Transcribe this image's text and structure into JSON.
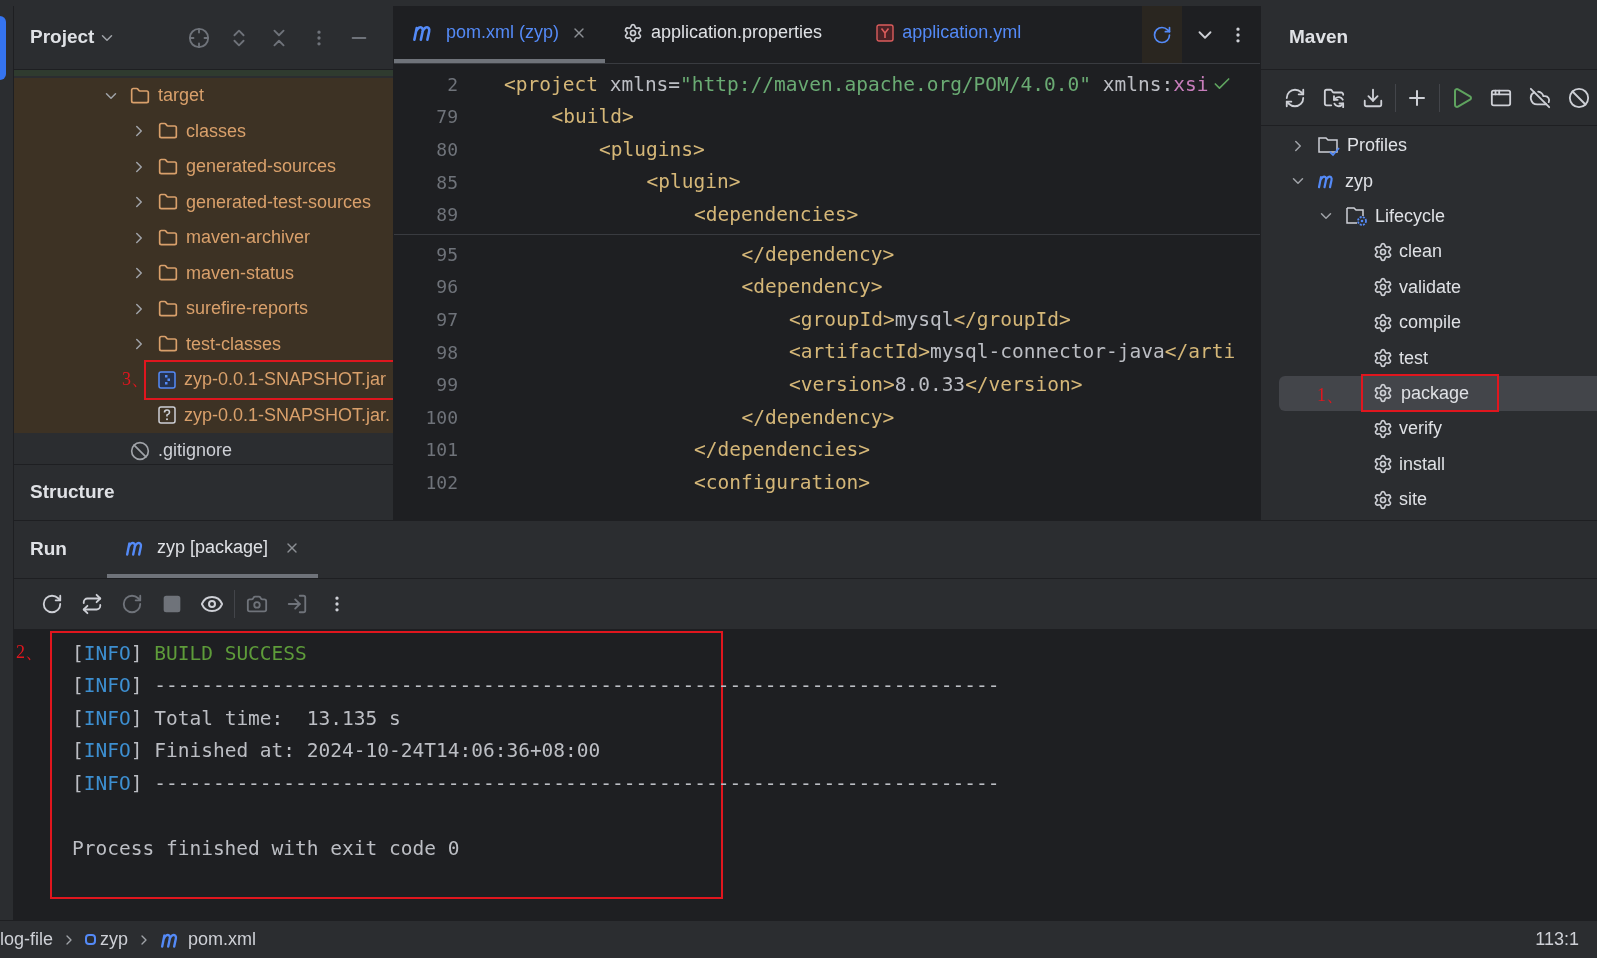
{
  "project_panel": {
    "title": "Project",
    "tree": [
      {
        "label": "target",
        "kind": "folder",
        "excluded": true,
        "expanded": true,
        "children": [
          {
            "label": "classes",
            "kind": "folder",
            "excluded": true,
            "expanded": false
          },
          {
            "label": "generated-sources",
            "kind": "folder",
            "excluded": true,
            "expanded": false
          },
          {
            "label": "generated-test-sources",
            "kind": "folder",
            "excluded": true,
            "expanded": false
          },
          {
            "label": "maven-archiver",
            "kind": "folder",
            "excluded": true,
            "expanded": false
          },
          {
            "label": "maven-status",
            "kind": "folder",
            "excluded": true,
            "expanded": false
          },
          {
            "label": "surefire-reports",
            "kind": "folder",
            "excluded": true,
            "expanded": false
          },
          {
            "label": "test-classes",
            "kind": "folder",
            "excluded": true,
            "expanded": false
          },
          {
            "label": "zyp-0.0.1-SNAPSHOT.jar",
            "kind": "jar",
            "excluded": true,
            "annotation": "3、"
          },
          {
            "label": "zyp-0.0.1-SNAPSHOT.jar.",
            "kind": "unknown",
            "excluded": true
          }
        ]
      },
      {
        "label": ".gitignore",
        "kind": "ignored",
        "excluded": false
      }
    ],
    "structure_title": "Structure"
  },
  "editor": {
    "tabs": [
      {
        "label": "pom.xml (zyp)",
        "kind": "maven",
        "selected": true,
        "closable": true
      },
      {
        "label": "application.properties",
        "kind": "settings",
        "selected": false,
        "closable": false
      },
      {
        "label": "application.yml",
        "kind": "yaml",
        "selected": false,
        "closable": false
      }
    ],
    "sticky_lines": [
      {
        "number": "2",
        "segments": [
          {
            "kind": "tag",
            "text": "<project"
          },
          {
            "kind": "attr",
            "text": " xmlns="
          },
          {
            "kind": "string",
            "text": "\"http://maven.apache.org/POM/4.0.0\""
          },
          {
            "kind": "attr",
            "text": " xmlns:"
          },
          {
            "kind": "ns",
            "text": "xsi"
          }
        ],
        "children": [
          {
            "number": "79",
            "segments": [
              {
                "kind": "tag",
                "text": "<build>"
              }
            ],
            "children": [
              {
                "number": "80",
                "segments": [
                  {
                    "kind": "tag",
                    "text": "<plugins>"
                  }
                ],
                "children": [
                  {
                    "number": "85",
                    "segments": [
                      {
                        "kind": "tag",
                        "text": "<plugin>"
                      }
                    ],
                    "children": [
                      {
                        "number": "89",
                        "segments": [
                          {
                            "kind": "tag",
                            "text": "<dependencies>"
                          }
                        ]
                      }
                    ]
                  }
                ]
              }
            ]
          }
        ]
      }
    ],
    "lines": [
      {
        "children": [
          {
            "number": "95",
            "segments": [
              {
                "kind": "tag",
                "text": "</dependency>"
              }
            ]
          },
          {
            "number": "96",
            "segments": [
              {
                "kind": "tag",
                "text": "<dependency>"
              }
            ],
            "children": [
              {
                "number": "97",
                "segments": [
                  {
                    "kind": "tag",
                    "text": "<groupId>"
                  },
                  {
                    "kind": "text",
                    "text": "mysql"
                  },
                  {
                    "kind": "tag",
                    "text": "</groupId>"
                  }
                ]
              },
              {
                "number": "98",
                "segments": [
                  {
                    "kind": "tag",
                    "text": "<artifactId>"
                  },
                  {
                    "kind": "text",
                    "text": "mysql-connector-java"
                  },
                  {
                    "kind": "tag",
                    "text": "</arti"
                  }
                ]
              },
              {
                "number": "99",
                "segments": [
                  {
                    "kind": "tag",
                    "text": "<version>"
                  },
                  {
                    "kind": "text",
                    "text": "8.0.33"
                  },
                  {
                    "kind": "tag",
                    "text": "</version>"
                  }
                ]
              }
            ]
          },
          {
            "number": "100",
            "segments": [
              {
                "kind": "tag",
                "text": "</dependency>"
              }
            ]
          }
        ]
      },
      {
        "number": "101",
        "segments": [
          {
            "kind": "tag",
            "text": "</dependencies>"
          }
        ]
      },
      {
        "number": "102",
        "segments": [
          {
            "kind": "tag",
            "text": "<configuration>"
          }
        ]
      }
    ]
  },
  "maven_panel": {
    "title": "Maven",
    "tree": [
      {
        "label": "Profiles",
        "kind": "profiles",
        "expanded": false,
        "selected": false
      },
      {
        "label": "zyp",
        "kind": "module",
        "expanded": true,
        "selected": false,
        "children": [
          {
            "label": "Lifecycle",
            "kind": "lifecycle",
            "expanded": true,
            "selected": false,
            "children": [
              {
                "label": "clean",
                "kind": "goal",
                "selected": false
              },
              {
                "label": "validate",
                "kind": "goal",
                "selected": false
              },
              {
                "label": "compile",
                "kind": "goal",
                "selected": false
              },
              {
                "label": "test",
                "kind": "goal",
                "selected": false
              },
              {
                "label": "package",
                "kind": "goal",
                "selected": true,
                "annotation": "1、"
              },
              {
                "label": "verify",
                "kind": "goal",
                "selected": false
              },
              {
                "label": "install",
                "kind": "goal",
                "selected": false
              },
              {
                "label": "site",
                "kind": "goal",
                "selected": false
              }
            ]
          }
        ]
      }
    ]
  },
  "run_panel": {
    "title": "Run",
    "tabs": [
      {
        "label": "zyp [package]",
        "selected": true,
        "closable": true
      }
    ],
    "console": {
      "annotation": "2、",
      "lines": [
        {
          "kind": "text",
          "segments": [
            {
              "kind": "bracket",
              "text": "["
            },
            {
              "kind": "info",
              "text": "INFO"
            },
            {
              "kind": "bracket",
              "text": "] "
            },
            {
              "kind": "success",
              "text": "BUILD SUCCESS"
            }
          ]
        },
        {
          "kind": "text",
          "segments": [
            {
              "kind": "bracket",
              "text": "["
            },
            {
              "kind": "info",
              "text": "INFO"
            },
            {
              "kind": "bracket",
              "text": "] "
            },
            {
              "kind": "plain",
              "text": "------------------------------------------------------------------------"
            }
          ]
        },
        {
          "kind": "text",
          "segments": [
            {
              "kind": "bracket",
              "text": "["
            },
            {
              "kind": "info",
              "text": "INFO"
            },
            {
              "kind": "bracket",
              "text": "] "
            },
            {
              "kind": "plain",
              "text": "Total time:  13.135 s"
            }
          ]
        },
        {
          "kind": "text",
          "segments": [
            {
              "kind": "bracket",
              "text": "["
            },
            {
              "kind": "info",
              "text": "INFO"
            },
            {
              "kind": "bracket",
              "text": "] "
            },
            {
              "kind": "plain",
              "text": "Finished at: 2024-10-24T14:06:36+08:00"
            }
          ]
        },
        {
          "kind": "text",
          "segments": [
            {
              "kind": "bracket",
              "text": "["
            },
            {
              "kind": "info",
              "text": "INFO"
            },
            {
              "kind": "bracket",
              "text": "] "
            },
            {
              "kind": "plain",
              "text": "------------------------------------------------------------------------"
            }
          ]
        },
        {
          "kind": "blank"
        },
        {
          "kind": "text",
          "segments": [
            {
              "kind": "plain",
              "text": "Process finished with exit code 0"
            }
          ]
        }
      ]
    }
  },
  "status_bar": {
    "breadcrumbs": [
      {
        "label": "log-file",
        "kind": "folder"
      },
      {
        "label": "zyp",
        "kind": "module-square"
      },
      {
        "label": "pom.xml",
        "kind": "maven"
      }
    ],
    "position": "113:1"
  }
}
